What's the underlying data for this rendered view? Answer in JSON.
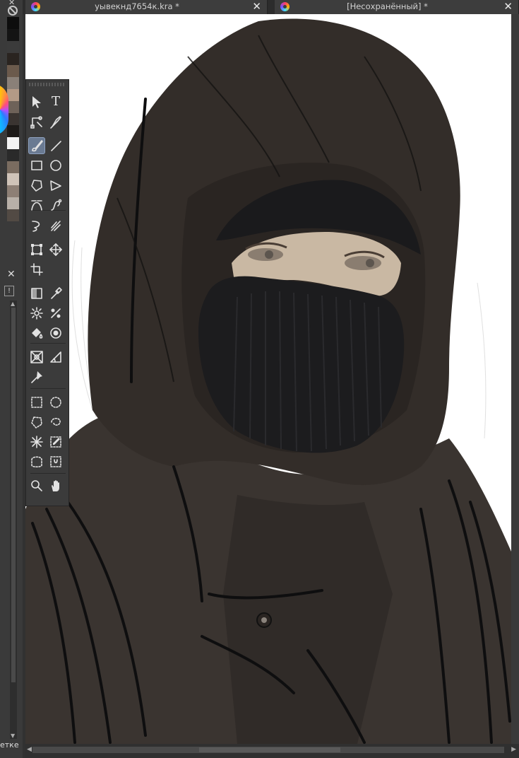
{
  "tabs": [
    {
      "title": "уывекнд7654к.kra *",
      "close": "✕"
    },
    {
      "title": "[Несохранённый]  *",
      "close": "✕"
    }
  ],
  "left_strip": {
    "top_close": "✕",
    "close": "✕",
    "info": "!",
    "bottom_label": "етке",
    "swatches": [
      "#0d0d0d",
      "#141414",
      "#3b3b3b",
      "#2a2420",
      "#6b5a4c",
      "#8a8078",
      "#b39a86",
      "#6e6259",
      "#3a3431",
      "#1e1b19",
      "#f4f4f4",
      "#2a2a2a",
      "#7a6c60",
      "#cfc3b8",
      "#8d7f75",
      "#b8b0a8",
      "#524a44"
    ]
  },
  "toolbox": {
    "tools": [
      {
        "name": "select-shapes-tool-icon"
      },
      {
        "name": "text-tool-icon",
        "glyph": "T"
      },
      {
        "name": "edit-shapes-tool-icon"
      },
      {
        "name": "calligraphy-tool-icon"
      },
      {
        "name": "freehand-brush-tool-icon",
        "active": true
      },
      {
        "name": "line-tool-icon"
      },
      {
        "name": "rectangle-tool-icon"
      },
      {
        "name": "ellipse-tool-icon"
      },
      {
        "name": "polygon-tool-icon"
      },
      {
        "name": "polyline-tool-icon"
      },
      {
        "name": "bezier-curve-tool-icon"
      },
      {
        "name": "freehand-path-tool-icon"
      },
      {
        "name": "dynamic-brush-tool-icon"
      },
      {
        "name": "multibrush-tool-icon"
      },
      {
        "name": "transform-tool-icon"
      },
      {
        "name": "move-tool-icon"
      },
      {
        "name": "crop-tool-icon"
      },
      {
        "name": "gradient-tool-icon"
      },
      {
        "name": "color-picker-tool-icon"
      },
      {
        "name": "colorize-mask-tool-icon"
      },
      {
        "name": "smart-patch-tool-icon"
      },
      {
        "name": "fill-tool-icon"
      },
      {
        "name": "enclose-and-fill-tool-icon"
      },
      {
        "name": "assistant-tool-icon"
      },
      {
        "name": "measure-tool-icon"
      },
      {
        "name": "reference-images-tool-icon"
      },
      {
        "name": "rectangular-selection-tool-icon"
      },
      {
        "name": "elliptical-selection-tool-icon"
      },
      {
        "name": "polygonal-selection-tool-icon"
      },
      {
        "name": "freehand-selection-tool-icon"
      },
      {
        "name": "contiguous-selection-tool-icon"
      },
      {
        "name": "similar-color-selection-tool-icon"
      },
      {
        "name": "bezier-selection-tool-icon"
      },
      {
        "name": "magnetic-selection-tool-icon"
      },
      {
        "name": "zoom-tool-icon"
      },
      {
        "name": "pan-tool-icon"
      }
    ]
  },
  "colors": {
    "canvas_bg": "#ffffff",
    "cloak": "#3a3430",
    "cloak_dark": "#2a2522",
    "mask": "#1c1c1e",
    "skin": "#c9b8a3",
    "ui_bg": "#3b3b3b"
  }
}
